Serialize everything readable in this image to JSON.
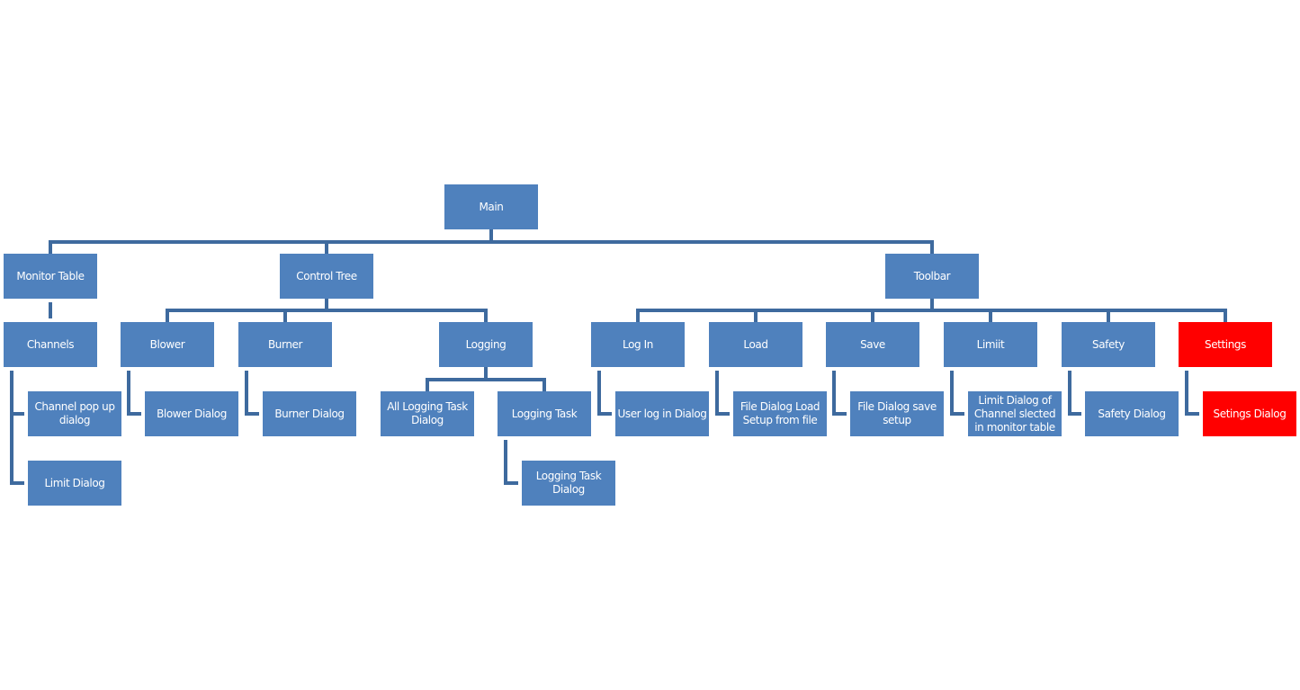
{
  "colors": {
    "box": "#4f81bd",
    "connector": "#3e6a9e",
    "highlight": "#ff0000"
  },
  "nodes": {
    "main": {
      "label": "Main"
    },
    "monitor_table": {
      "label": "Monitor Table"
    },
    "channels": {
      "label": "Channels"
    },
    "channel_popup": {
      "label": "Channel pop up dialog"
    },
    "limit_dialog": {
      "label": "Limit Dialog"
    },
    "control_tree": {
      "label": "Control Tree"
    },
    "blower": {
      "label": "Blower"
    },
    "blower_dialog": {
      "label": "Blower Dialog"
    },
    "burner": {
      "label": "Burner"
    },
    "burner_dialog": {
      "label": "Burner Dialog"
    },
    "logging": {
      "label": "Logging"
    },
    "all_logging_task_dialog": {
      "label": "All Logging Task Dialog"
    },
    "logging_task": {
      "label": "Logging Task"
    },
    "logging_task_dialog": {
      "label": "Logging Task Dialog"
    },
    "toolbar": {
      "label": "Toolbar"
    },
    "log_in": {
      "label": "Log In"
    },
    "user_login_dialog": {
      "label": "User log in Dialog"
    },
    "load": {
      "label": "Load"
    },
    "file_dialog_load": {
      "label": "File Dialog Load Setup from file"
    },
    "save": {
      "label": "Save"
    },
    "file_dialog_save": {
      "label": "File Dialog save setup"
    },
    "limiit": {
      "label": "Limiit"
    },
    "limit_dialog_channel": {
      "label": "Limit Dialog of Channel slected in monitor table"
    },
    "safety": {
      "label": "Safety"
    },
    "safety_dialog": {
      "label": "Safety Dialog"
    },
    "settings": {
      "label": "Settings",
      "highlighted": true
    },
    "setings_dialog": {
      "label": "Setings Dialog",
      "highlighted": true
    }
  },
  "tree": {
    "main": [
      "monitor_table",
      "control_tree",
      "toolbar"
    ],
    "monitor_table": [
      "channels"
    ],
    "channels": [
      "channel_popup",
      "limit_dialog"
    ],
    "control_tree": [
      "blower",
      "burner",
      "logging"
    ],
    "blower": [
      "blower_dialog"
    ],
    "burner": [
      "burner_dialog"
    ],
    "logging": [
      "all_logging_task_dialog",
      "logging_task"
    ],
    "logging_task": [
      "logging_task_dialog"
    ],
    "toolbar": [
      "log_in",
      "load",
      "save",
      "limiit",
      "safety",
      "settings"
    ],
    "log_in": [
      "user_login_dialog"
    ],
    "load": [
      "file_dialog_load"
    ],
    "save": [
      "file_dialog_save"
    ],
    "limiit": [
      "limit_dialog_channel"
    ],
    "safety": [
      "safety_dialog"
    ],
    "settings": [
      "setings_dialog"
    ]
  }
}
